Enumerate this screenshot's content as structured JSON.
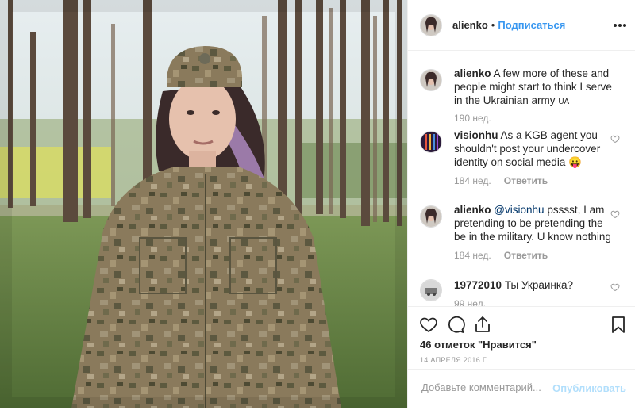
{
  "post": {
    "author": "alienko",
    "dot": "•",
    "follow_label": "Подписаться",
    "likes_text": "46 отметок \"Нравится\"",
    "date_text": "14 АПРЕЛЯ 2016 Г.",
    "comment_placeholder": "Добавьте комментарий...",
    "publish_label": "Опубликовать"
  },
  "caption": {
    "username": "alienko",
    "text": "A few more of these and people might start to think I serve in the Ukrainian army",
    "flag": "UA",
    "time": "190 нед."
  },
  "comments": [
    {
      "username": "visionhu",
      "text": "As a KGB agent you shouldn't post your undercover identity on social media",
      "emoji": "😛",
      "time": "184 нед.",
      "reply": "Ответить"
    },
    {
      "username": "alienko",
      "mention": "@visionhu",
      "text": "psssst, I am pretending to be pretending the be in the military. U know nothing",
      "time": "184 нед.",
      "reply": "Ответить"
    },
    {
      "username": "19772010",
      "text": "Ты Украинка?",
      "time": "99 нед."
    }
  ],
  "icons": {
    "heart": "heart-icon",
    "comment": "comment-icon",
    "share": "share-icon",
    "save": "bookmark-icon",
    "more": "more-options-icon"
  },
  "colors": {
    "link": "#3897f0",
    "publish_disabled": "#b2dffc",
    "muted": "#999999"
  }
}
